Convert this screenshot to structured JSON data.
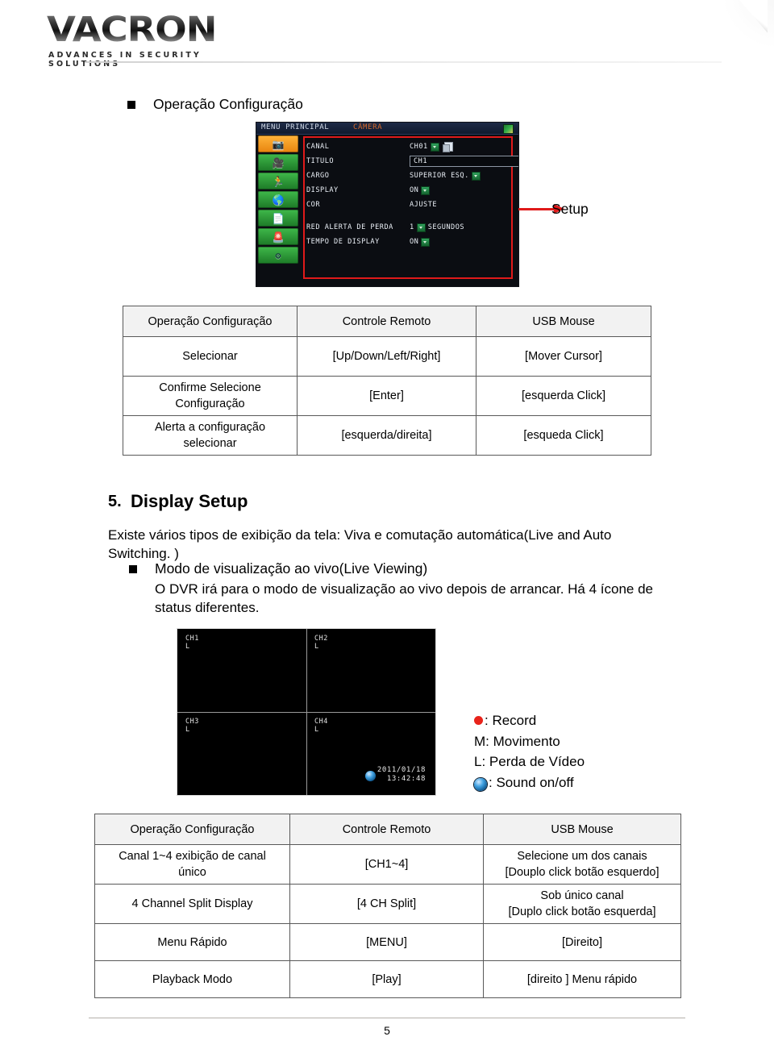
{
  "brand": {
    "logo_text": "VACRON",
    "tagline": "ADVANCES IN SECURITY SOLUTIONS"
  },
  "section_heading": {
    "bullet_label": "Operação Configuração"
  },
  "dvr_menu": {
    "title_main": "MENU PRINCIPAL",
    "title_sub": "CÂMERA",
    "sidebar_icons": [
      {
        "name": "camera-icon",
        "glyph": "■",
        "selected": true
      },
      {
        "name": "record-film-icon",
        "glyph": "●",
        "selected": false
      },
      {
        "name": "motion-detect-icon",
        "glyph": "⚑",
        "selected": false
      },
      {
        "name": "network-globe-icon",
        "glyph": "●",
        "selected": false
      },
      {
        "name": "system-document-icon",
        "glyph": "▬",
        "selected": false
      },
      {
        "name": "alarm-icon",
        "glyph": "●",
        "selected": false
      },
      {
        "name": "settings-gears-icon",
        "glyph": "⚙",
        "selected": false
      }
    ],
    "rows": [
      {
        "label": "CANAL",
        "value": "CH01",
        "control": "dropdown-copy"
      },
      {
        "label": "TITULO",
        "value": "CH1",
        "control": "textbox"
      },
      {
        "label": "CARGO",
        "value": "SUPERIOR ESQ.",
        "control": "dropdown"
      },
      {
        "label": "DISPLAY",
        "value": "ON",
        "control": "dropdown"
      },
      {
        "label": "COR",
        "value": "AJUSTE",
        "control": "plain"
      },
      {
        "label": "",
        "value": "",
        "control": "spacer"
      },
      {
        "label": "RED ALERTA DE PERDA",
        "value": "1",
        "control": "dropdown",
        "suffix": "SEGUNDOS"
      },
      {
        "label": "TEMPO DE DISPLAY",
        "value": "ON",
        "control": "dropdown"
      }
    ],
    "callout_label": "Setup",
    "callout_color": "#e01a1a"
  },
  "table_ops_config": {
    "headers": [
      "Operação Configuração",
      "Controle Remoto",
      "USB Mouse"
    ],
    "rows": [
      [
        "Selecionar",
        "[Up/Down/Left/Right]",
        "[Mover Cursor]"
      ],
      [
        "Confirme Selecione\nConfiguração",
        "[Enter]",
        "[esquerda Click]"
      ],
      [
        "Alerta a configuração\nselecionar",
        "[esquerda/direita]",
        "[esqueda Click]"
      ]
    ]
  },
  "display_setup": {
    "number": "5.",
    "title": "Display Setup",
    "intro": "Existe vários tipos de exibição da tela: Viva e comutação automática(Live and Auto Switching. )",
    "bullet_label": "Modo de visualização ao vivo(Live Viewing)",
    "bullet_body": "O DVR irá para o modo de visualização ao vivo depois de arrancar. Há 4 ícone de status diferentes."
  },
  "live_view": {
    "channels": [
      {
        "name": "CH1",
        "status": "L"
      },
      {
        "name": "CH2",
        "status": "L"
      },
      {
        "name": "CH3",
        "status": "L"
      },
      {
        "name": "CH4",
        "status": "L"
      }
    ],
    "timestamp_date": "2011/01/18",
    "timestamp_time": "13:42:48"
  },
  "legend": {
    "items": [
      {
        "icon": "record-dot",
        "text": ": Record"
      },
      {
        "icon": "letter-m",
        "text": "M: Movimento"
      },
      {
        "icon": "letter-l",
        "text": "L: Perda de Vídeo"
      },
      {
        "icon": "sound-icon",
        "text": ": Sound on/off"
      }
    ]
  },
  "table_display_ops": {
    "headers": [
      "Operação Configuração",
      "Controle Remoto",
      "USB Mouse"
    ],
    "rows": [
      [
        "Canal 1~4 exibição de canal\núnico",
        "[CH1~4]",
        "Selecione um dos canais\n[Douplo click botão esquerdo]"
      ],
      [
        "4 Channel Split Display",
        "[4 CH Split]",
        "Sob único canal\n[Duplo click botão esquerda]"
      ],
      [
        "Menu Rápido",
        "[MENU]",
        "[Direito]"
      ],
      [
        "Playback Modo",
        "[Play]",
        "[direito ] Menu rápido"
      ]
    ]
  },
  "footer": {
    "page_number": "5"
  }
}
